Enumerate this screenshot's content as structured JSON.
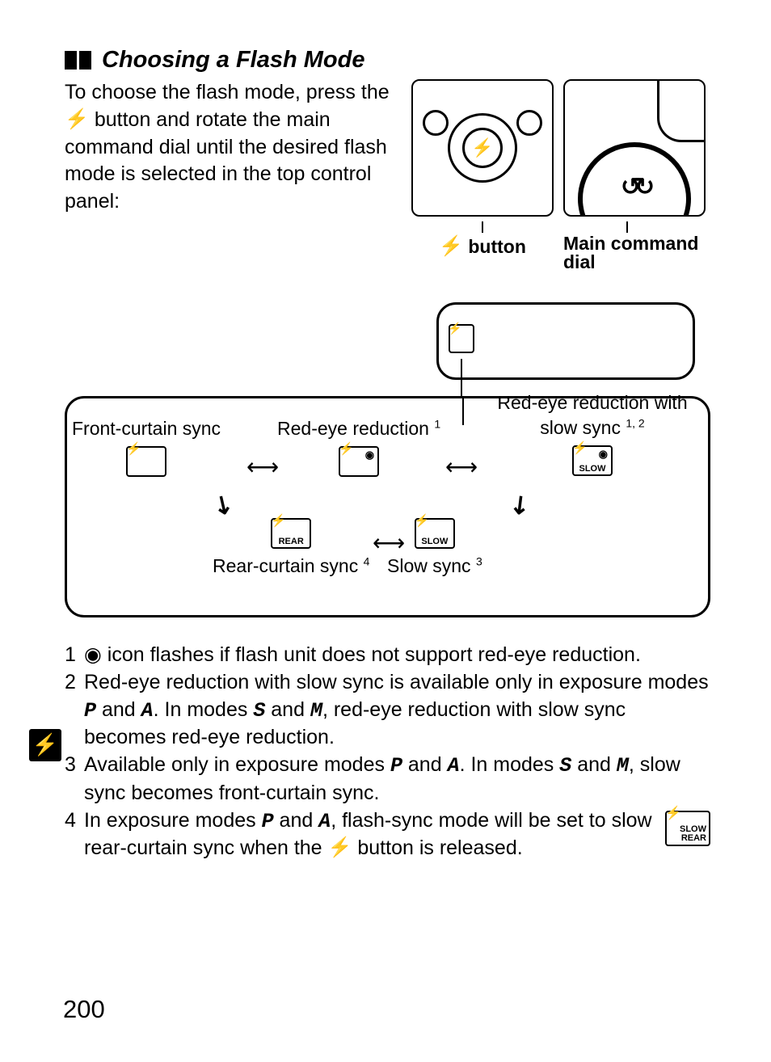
{
  "page_number": "200",
  "heading": "Choosing a Flash Mode",
  "intro": {
    "part1": "To choose the flash mode, press the ",
    "part2": " button and rotate the main command dial until the desired flash mode is selected in the top control panel:"
  },
  "glyphs": {
    "flash": "⚡",
    "eye": "◉",
    "mode_P": "P",
    "mode_A": "A",
    "mode_S": "S",
    "mode_M": "M"
  },
  "captions": {
    "flash_button": "button",
    "main_command_dial": "Main command dial"
  },
  "modes": {
    "front_curtain": {
      "label": "Front-curtain sync",
      "badge": ""
    },
    "red_eye": {
      "label": "Red-eye reduction",
      "sup": "1",
      "badge": ""
    },
    "red_eye_slow": {
      "label": "Red-eye reduction with slow sync",
      "sup": "1, 2",
      "badge": "SLOW"
    },
    "rear_curtain": {
      "label": "Rear-curtain sync",
      "sup": "4",
      "badge": "REAR"
    },
    "slow_sync": {
      "label": "Slow sync",
      "sup": "3",
      "badge": "SLOW"
    }
  },
  "footnotes": {
    "n1": {
      "num": "1",
      "text_a": "icon flashes if flash unit does not support red-eye reduction."
    },
    "n2": {
      "num": "2",
      "text_a": "Red-eye reduction with slow sync is available only in exposure modes ",
      "text_b": " and ",
      "text_c": ".  In modes ",
      "text_d": " and ",
      "text_e": ", red-eye reduction with slow sync becomes red-eye reduction."
    },
    "n3": {
      "num": "3",
      "text_a": "Available only in exposure modes ",
      "text_b": " and ",
      "text_c": ".  In modes ",
      "text_d": " and ",
      "text_e": ", slow sync becomes front-curtain sync."
    },
    "n4": {
      "num": "4",
      "text_a": "In exposure modes ",
      "text_b": " and ",
      "text_c": ", flash-sync mode will be set to slow rear-curtain sync when the ",
      "text_d": " button is released.",
      "icon_line1": "SLOW",
      "icon_line2": "REAR"
    }
  }
}
